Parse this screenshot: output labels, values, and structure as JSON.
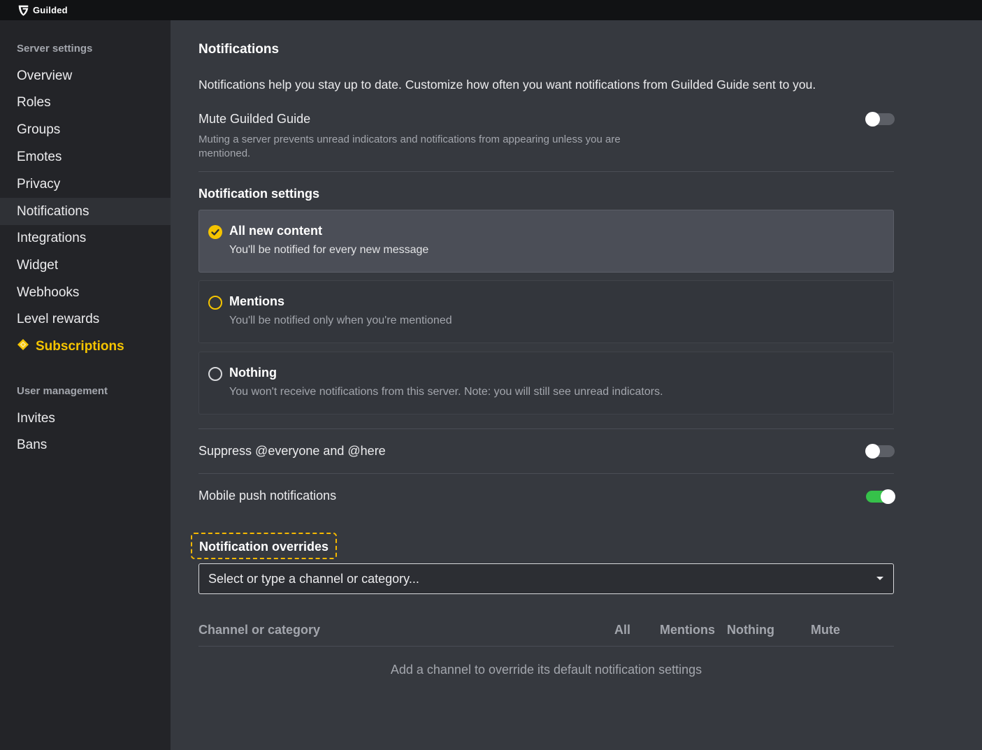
{
  "app": {
    "name": "Guilded"
  },
  "colors": {
    "accent": "#f5c400",
    "toggle_on": "#36c14a",
    "sidebar_bg": "#232428",
    "main_bg": "#36393f"
  },
  "sidebar": {
    "server_settings_title": "Server settings",
    "server_items": [
      {
        "label": "Overview"
      },
      {
        "label": "Roles"
      },
      {
        "label": "Groups"
      },
      {
        "label": "Emotes"
      },
      {
        "label": "Privacy"
      },
      {
        "label": "Notifications",
        "active": true
      },
      {
        "label": "Integrations"
      },
      {
        "label": "Widget"
      },
      {
        "label": "Webhooks"
      },
      {
        "label": "Level rewards"
      },
      {
        "label": "Subscriptions",
        "icon": "diamond-icon"
      }
    ],
    "user_management_title": "User management",
    "user_items": [
      {
        "label": "Invites"
      },
      {
        "label": "Bans"
      }
    ]
  },
  "main": {
    "title": "Notifications",
    "description": "Notifications help you stay up to date. Customize how often you want notifications from Guilded Guide sent to you.",
    "mute": {
      "label": "Mute Guilded Guide",
      "help": "Muting a server prevents unread indicators and notifications from appearing unless you are mentioned.",
      "enabled": false
    },
    "notification_settings": {
      "title": "Notification settings",
      "options": [
        {
          "title": "All new content",
          "desc": "You'll be notified for every new message",
          "selected": true
        },
        {
          "title": "Mentions",
          "desc": "You'll be notified only when you're mentioned",
          "selected": false
        },
        {
          "title": "Nothing",
          "desc": "You won't receive notifications from this server. Note: you will still see unread indicators.",
          "selected": false
        }
      ]
    },
    "suppress": {
      "label": "Suppress @everyone and @here",
      "enabled": false
    },
    "mobile_push": {
      "label": "Mobile push notifications",
      "enabled": true
    },
    "overrides": {
      "title": "Notification overrides",
      "select_placeholder": "Select or type a channel or category...",
      "columns": {
        "channel": "Channel or category",
        "all": "All",
        "mentions": "Mentions",
        "nothing": "Nothing",
        "mute": "Mute"
      },
      "empty_text": "Add a channel to override its default notification settings"
    }
  }
}
